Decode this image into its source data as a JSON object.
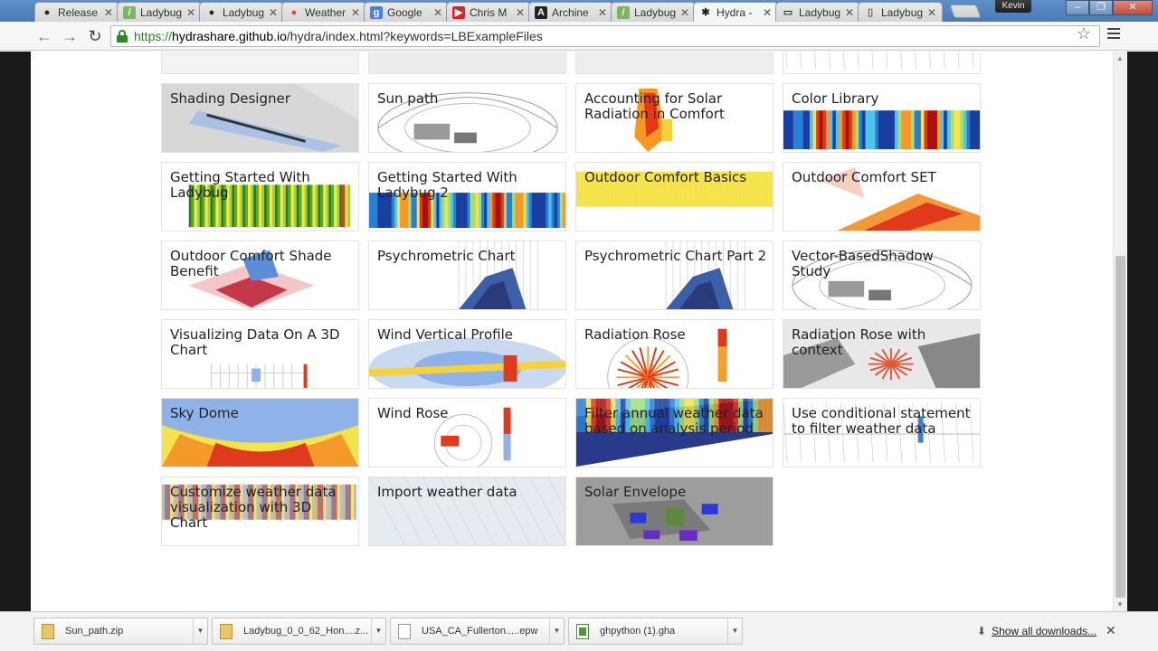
{
  "browser": {
    "tabs": [
      {
        "label": "Release",
        "icon": "github-icon",
        "active": false
      },
      {
        "label": "Ladybug",
        "icon": "grasshopper-icon",
        "active": false
      },
      {
        "label": "Ladybug",
        "icon": "github-icon",
        "active": false
      },
      {
        "label": "Weather",
        "icon": "chrome-icon",
        "active": false
      },
      {
        "label": "Google",
        "icon": "google-icon",
        "active": false
      },
      {
        "label": "Chris M",
        "icon": "youtube-icon",
        "active": false
      },
      {
        "label": "Archine",
        "icon": "archinect-icon",
        "active": false
      },
      {
        "label": "Ladybug",
        "icon": "grasshopper-icon",
        "active": false
      },
      {
        "label": "Hydra -",
        "icon": "hydra-icon",
        "active": true
      },
      {
        "label": "Ladybug",
        "icon": "book-icon",
        "active": false
      },
      {
        "label": "Ladybug",
        "icon": "page-icon",
        "active": false
      }
    ],
    "user": "Kevin",
    "url": {
      "scheme": "https://",
      "host": "hydrashare.github.io",
      "path": "/hydra/index.html?keywords=LBExampleFiles"
    }
  },
  "gallery": {
    "cards": [
      {
        "title": "",
        "theme": "plan"
      },
      {
        "title": "",
        "theme": "dark"
      },
      {
        "title": "",
        "theme": "grey"
      },
      {
        "title": "",
        "theme": "lines"
      },
      {
        "title": "Shading Designer",
        "theme": "shade"
      },
      {
        "title": "Sun path",
        "theme": "wire"
      },
      {
        "title": "Accounting for Solar Radiation in Comfort",
        "theme": "figure"
      },
      {
        "title": "Color Library",
        "theme": "heat"
      },
      {
        "title": "Getting Started With Ladybug",
        "theme": "green"
      },
      {
        "title": "Getting Started With Ladybug 2",
        "theme": "blueheat"
      },
      {
        "title": "Outdoor Comfort Basics",
        "theme": "yellowheat"
      },
      {
        "title": "Outdoor Comfort SET",
        "theme": "diag"
      },
      {
        "title": "Outdoor Comfort Shade Benefit",
        "theme": "redblue"
      },
      {
        "title": "Psychrometric Chart",
        "theme": "psych"
      },
      {
        "title": "Psychrometric Chart Part 2",
        "theme": "psych"
      },
      {
        "title": "Vector-BasedShadow Study",
        "theme": "wire"
      },
      {
        "title": "Visualizing Data On A 3D Chart",
        "theme": "grid"
      },
      {
        "title": "Wind Vertical Profile",
        "theme": "wind"
      },
      {
        "title": "Radiation Rose",
        "theme": "rose"
      },
      {
        "title": "Radiation Rose with context",
        "theme": "roseCtx"
      },
      {
        "title": "Sky Dome",
        "theme": "sky"
      },
      {
        "title": "Wind Rose",
        "theme": "windrose"
      },
      {
        "title": "Filter annual weather data based on analysis period",
        "theme": "filter"
      },
      {
        "title": "Use conditional statement to filter weather data",
        "theme": "lines"
      },
      {
        "title": "Customize weather data visualization with 3D Chart",
        "theme": "stripes"
      },
      {
        "title": "Import weather data",
        "theme": "pale"
      },
      {
        "title": "Solar Envelope",
        "theme": "solar"
      }
    ]
  },
  "downloads": {
    "items": [
      {
        "name": "Sun_path.zip",
        "kind": "zip"
      },
      {
        "name": "Ladybug_0_0_62_Hon....z...",
        "kind": "zip"
      },
      {
        "name": "USA_CA_Fullerton.....epw",
        "kind": "doc"
      },
      {
        "name": "ghpython (1).gha",
        "kind": "gha"
      }
    ],
    "show_all": "Show all downloads..."
  }
}
